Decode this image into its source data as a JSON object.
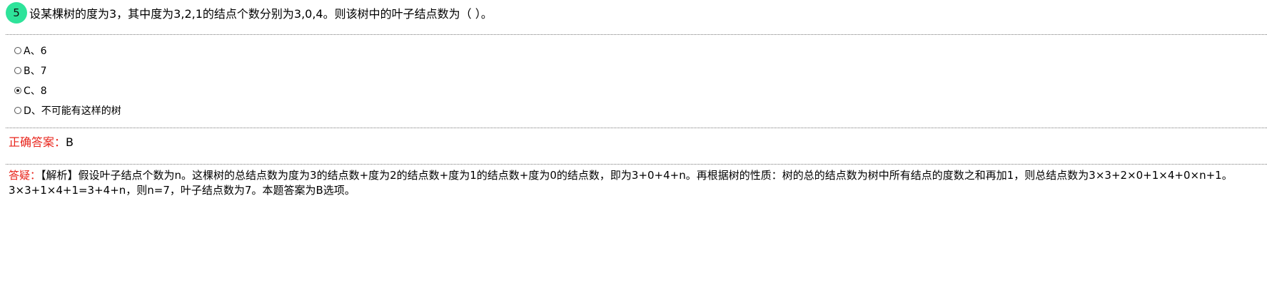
{
  "question": {
    "number": "5",
    "text": "设某棵树的度为3，其中度为3,2,1的结点个数分别为3,0,4。则该树中的叶子结点数为（ ）。"
  },
  "options": [
    {
      "label": "A、6",
      "checked": false
    },
    {
      "label": "B、7",
      "checked": false
    },
    {
      "label": "C、8",
      "checked": true
    },
    {
      "label": "D、不可能有这样的树",
      "checked": false
    }
  ],
  "answer": {
    "label": "正确答案：",
    "value": "B"
  },
  "explanation": {
    "label": "答疑：",
    "text": "【解析】假设叶子结点个数为n。这棵树的总结点数为度为3的结点数+度为2的结点数+度为1的结点数+度为0的结点数，即为3+0+4+n。再根据树的性质：树的总的结点数为树中所有结点的度数之和再加1，则总结点数为3×3+2×0+1×4+0×n+1。3×3+1×4+1=3+4+n，则n=7，叶子结点数为7。本题答案为B选项。"
  },
  "colors": {
    "badge": "#2ee39a",
    "label_red": "#e8231a"
  }
}
